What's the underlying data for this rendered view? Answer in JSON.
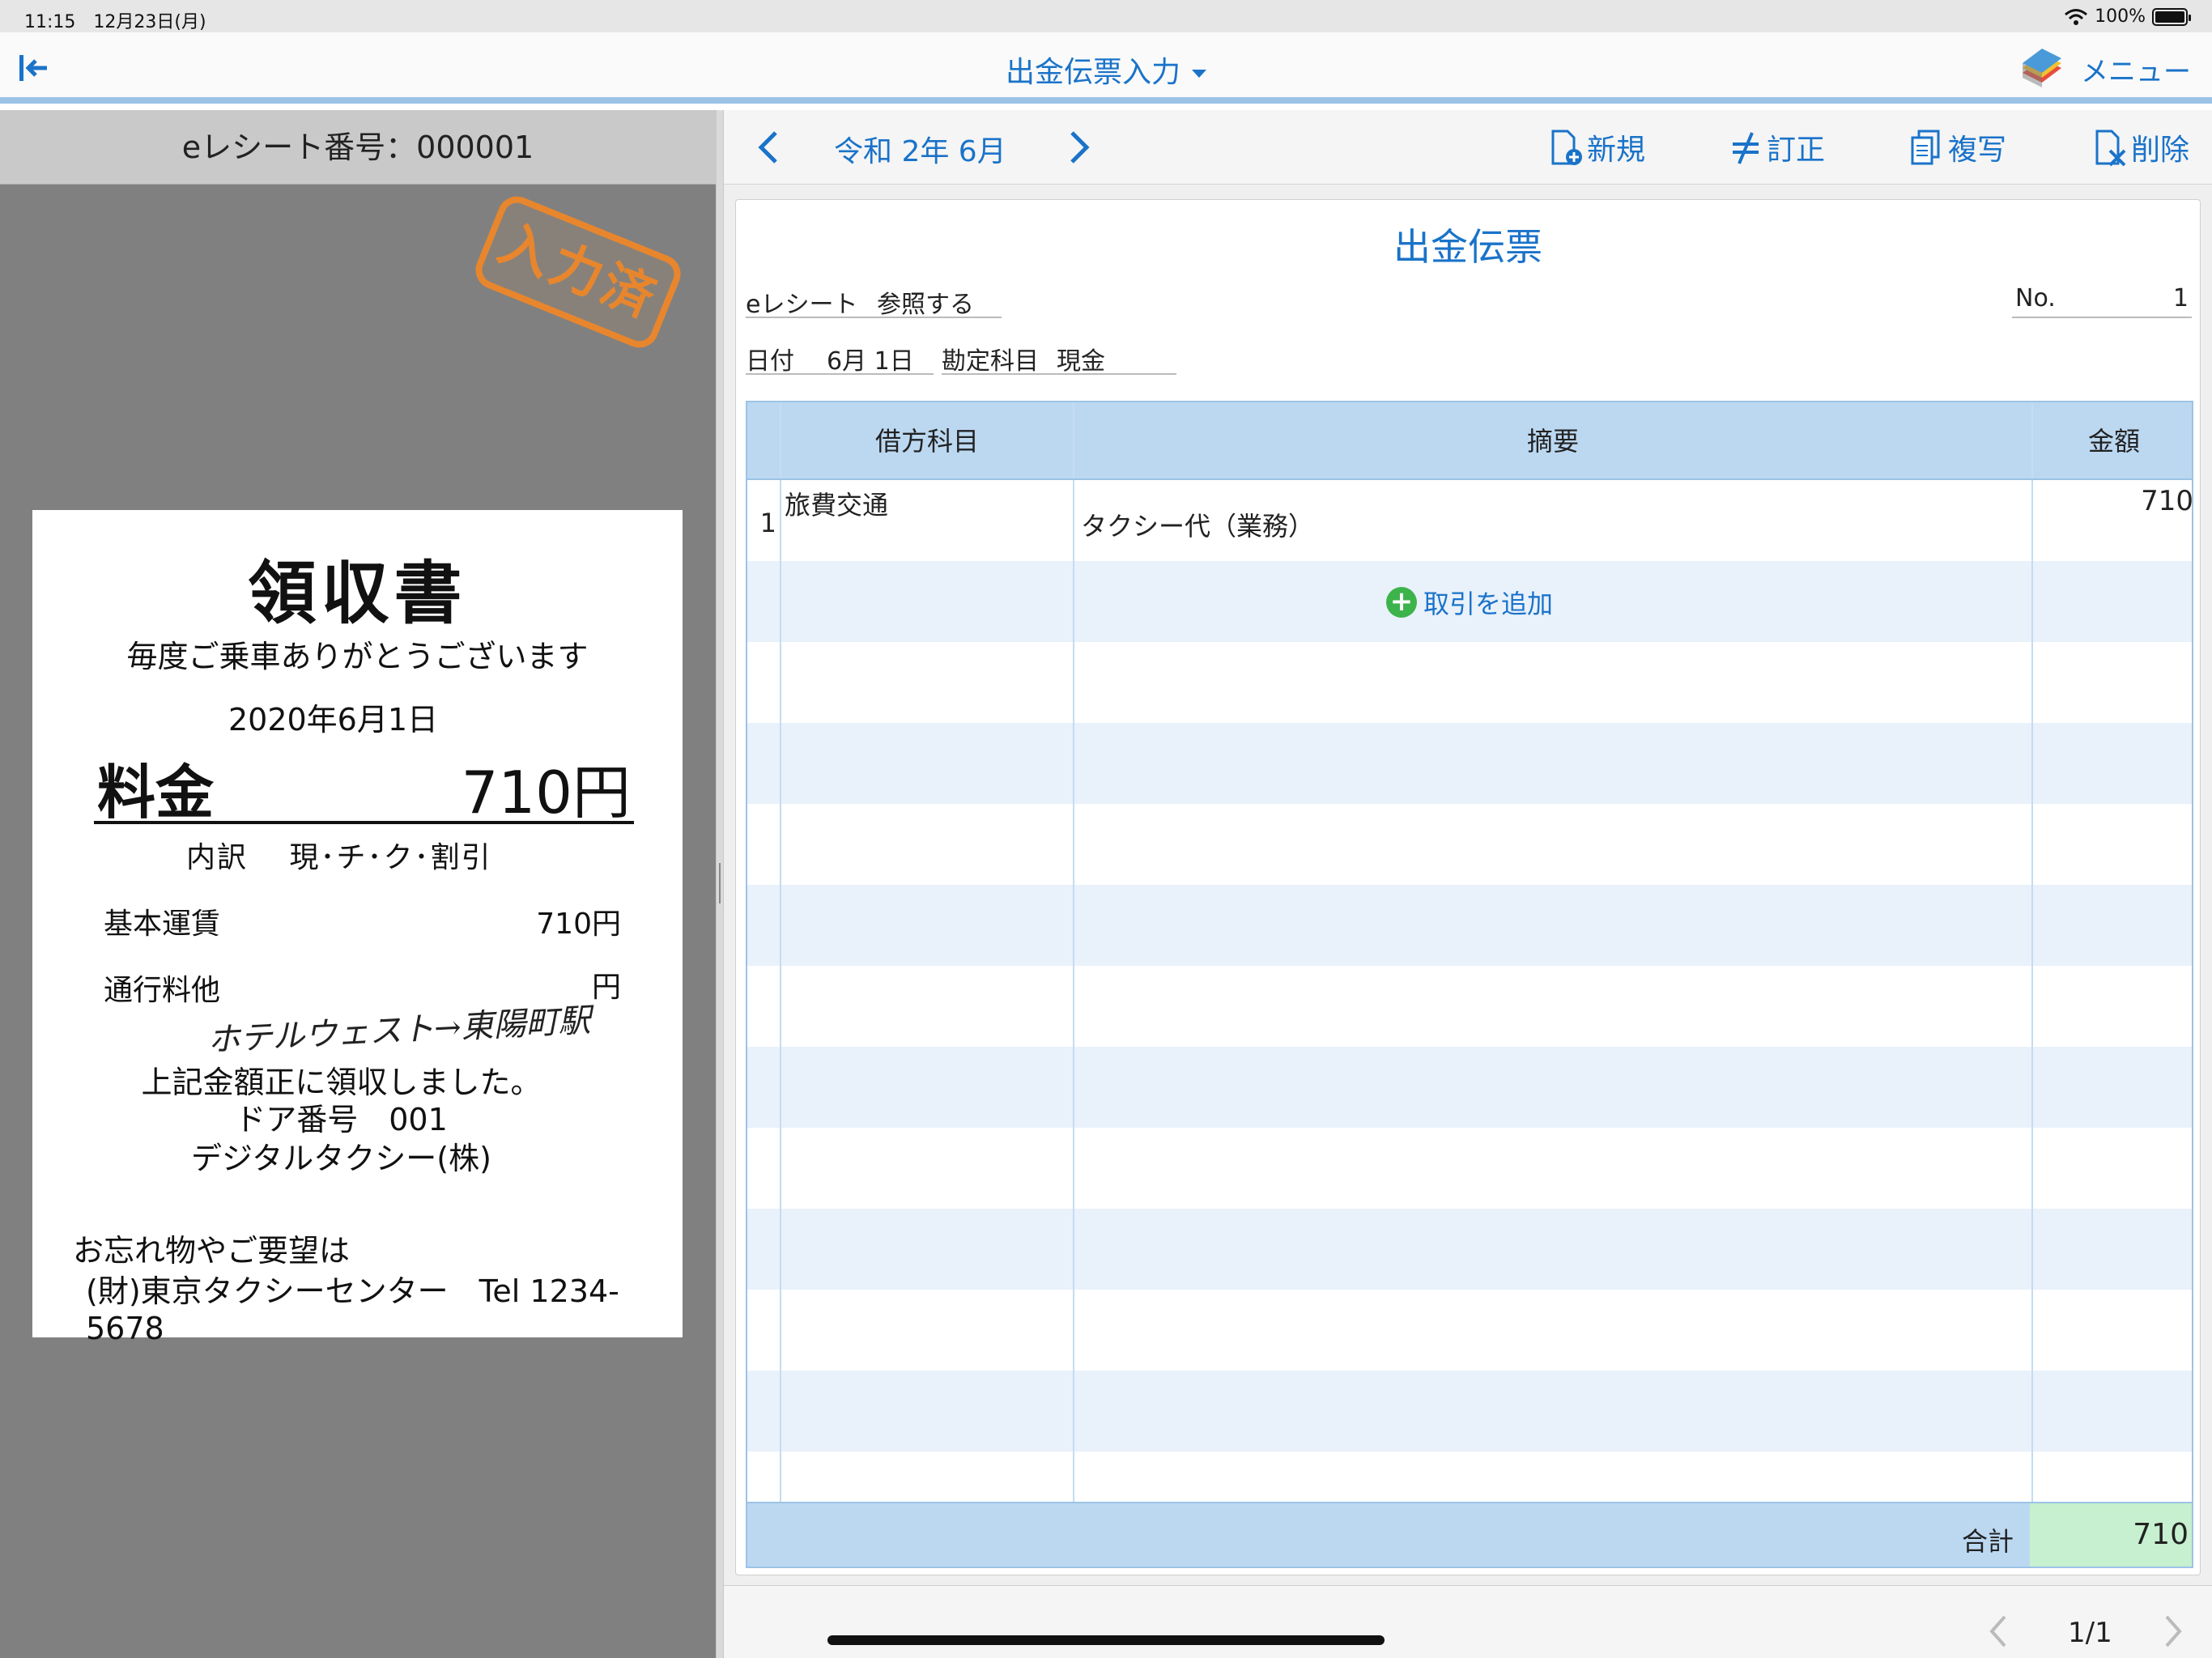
{
  "status": {
    "time": "11:15",
    "date": "12月23日(月)",
    "battery": "100%"
  },
  "nav": {
    "title": "出金伝票入力",
    "menu_label": "メニュー"
  },
  "left": {
    "header": "eレシート番号：000001",
    "stamp": "入力済",
    "receipt": {
      "title": "領収書",
      "greeting": "毎度ご乗車ありがとうございます",
      "date": "2020年6月1日",
      "fee_label": "料金",
      "fee_value": "710円",
      "breakdown": "内訳　 現･チ･ク･割引",
      "base_label": "基本運賃",
      "base_value": "710円",
      "toll_label": "通行料他",
      "toll_value": "円",
      "handwritten": "ホテルウェスト→東陽町駅",
      "received": "上記金額正に領収しました。",
      "door": "ドア番号　001",
      "company": "デジタルタクシー(株)",
      "lost": "お忘れ物やご要望は",
      "center": "(財)東京タクシーセンター　Tel 1234-5678"
    }
  },
  "toolbar": {
    "period": "令和 2年 6月",
    "new_label": "新規",
    "correct_label": "訂正",
    "copy_label": "複写",
    "delete_label": "削除"
  },
  "slip": {
    "title": "出金伝票",
    "ereceipt_label": "eレシート",
    "ereceipt_value": "参照する",
    "no_label": "No.",
    "no_value": "1",
    "date_label": "日付",
    "date_value": "6月 1日",
    "account_label": "勘定科目",
    "account_value": "現金",
    "columns": {
      "debit": "借方科目",
      "summary": "摘要",
      "amount": "金額"
    },
    "rows": [
      {
        "no": "1",
        "debit": "旅費交通",
        "summary": "タクシー代（業務）",
        "amount": "710"
      }
    ],
    "add_label": "取引を追加",
    "total_label": "合計",
    "total_value": "710"
  },
  "pager": {
    "count": "1/1"
  }
}
